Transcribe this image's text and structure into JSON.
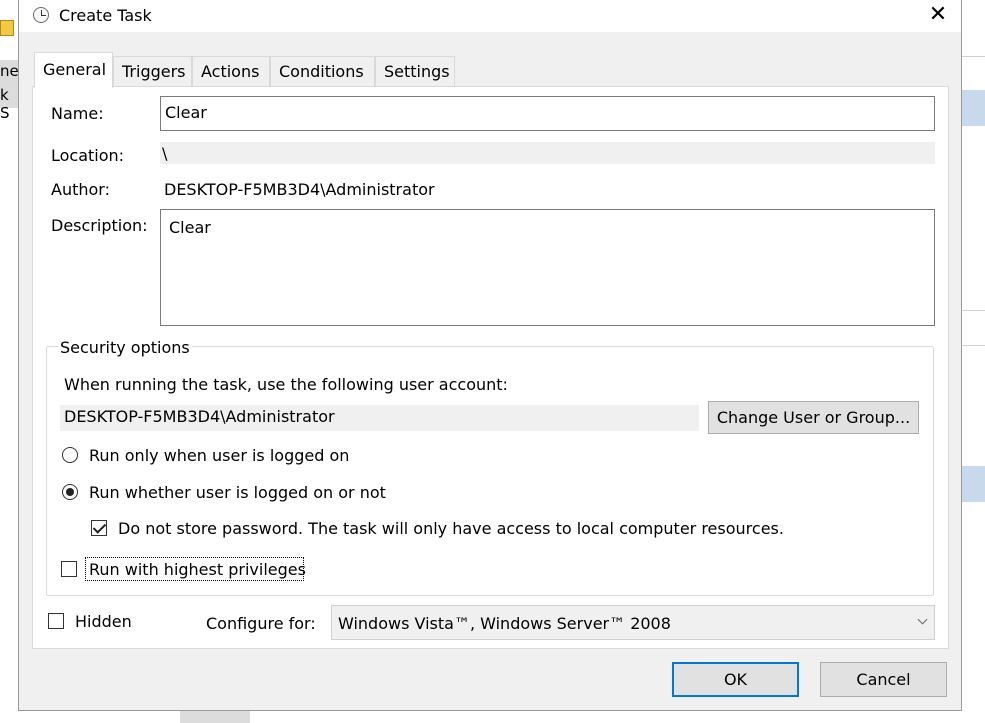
{
  "background": {
    "left_text_1": "ne",
    "left_text_2": "k S"
  },
  "window": {
    "title": "Create Task",
    "close_glyph": "✕"
  },
  "tabs": [
    {
      "label": "General",
      "active": true
    },
    {
      "label": "Triggers",
      "active": false
    },
    {
      "label": "Actions",
      "active": false
    },
    {
      "label": "Conditions",
      "active": false
    },
    {
      "label": "Settings",
      "active": false
    }
  ],
  "general": {
    "name_label": "Name:",
    "name_value": "Clear",
    "location_label": "Location:",
    "location_value": "\\",
    "author_label": "Author:",
    "author_value": "DESKTOP-F5MB3D4\\Administrator",
    "description_label": "Description:",
    "description_value": "Clear"
  },
  "security": {
    "group_label": "Security options",
    "account_prompt": "When running the task, use the following user account:",
    "account_value": "DESKTOP-F5MB3D4\\Administrator",
    "change_user_button": "Change User or Group...",
    "radio_logged_on": {
      "label": "Run only when user is logged on",
      "checked": false
    },
    "radio_whether": {
      "label": "Run whether user is logged on or not",
      "checked": true
    },
    "no_store_password": {
      "label": "Do not store password.  The task will only have access to local computer resources.",
      "checked": true
    },
    "highest_privileges": {
      "label": "Run with highest privileges",
      "checked": false
    }
  },
  "footer": {
    "hidden": {
      "label": "Hidden",
      "checked": false
    },
    "configure_label": "Configure for:",
    "configure_value": "Windows Vista™, Windows Server™ 2008",
    "ok_button": "OK",
    "cancel_button": "Cancel"
  },
  "colors": {
    "accent": "#0078d7",
    "dialog_bg": "#f0f0f0",
    "panel_bg": "#ffffff"
  }
}
